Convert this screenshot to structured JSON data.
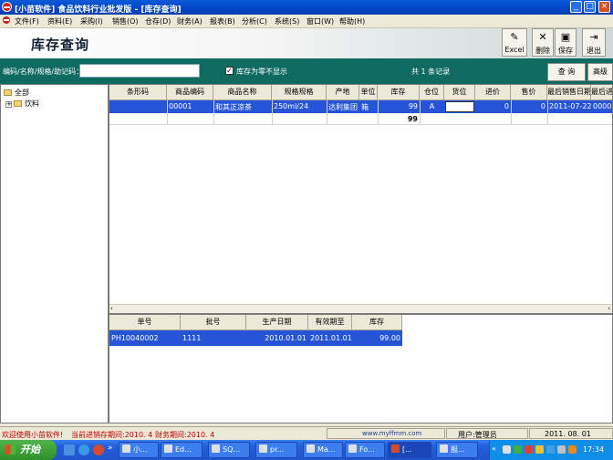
{
  "window": {
    "title": "[小苗软件] 食品饮料行业批发版 - [库存查询]"
  },
  "menu": [
    "文件(F)",
    "资料(E)",
    "采购(I)",
    "销售(O)",
    "仓存(D)",
    "财务(A)",
    "报表(B)",
    "分析(C)",
    "系统(S)",
    "窗口(W)",
    "帮助(H)"
  ],
  "page": {
    "title": "库存查询"
  },
  "toolbar": {
    "excel": "Excel",
    "delete": "删除",
    "save": "保存",
    "exit": "退出"
  },
  "search": {
    "label": "编码/名称/规格/助记码：",
    "value": "",
    "zero_checked": true,
    "zero_label": "库存为零不显示",
    "record_count": "共 1 条记录",
    "query_button": "查 询",
    "advanced_button": "高级"
  },
  "tree": {
    "root": "全部",
    "child": "饮料"
  },
  "stock_grid": {
    "columns": [
      "条形码",
      "商品编码",
      "商品名称",
      "规格规格",
      "产地",
      "单位",
      "库存",
      "仓位",
      "货位",
      "进价",
      "售价",
      "最后销售日期",
      "最后进"
    ],
    "rows": [
      [
        "",
        "00001",
        "和其正凉茶",
        "250ml/24",
        "达利集团",
        "箱",
        "99",
        "A",
        "",
        "0",
        "0",
        "2011-07-22",
        "0000"
      ]
    ],
    "total_stock": "99"
  },
  "batch_grid": {
    "columns": [
      "单号",
      "批号",
      "生产日期",
      "有效期至",
      "库存"
    ],
    "rows": [
      [
        "PH10040002",
        "1111",
        "2010.01.01",
        "2011.01.01",
        "99.00"
      ]
    ]
  },
  "status": {
    "welcome": "欢迎使用小苗软件!",
    "purchase_period": "当前进销存期间:2010. 4",
    "finance_period": "财务期间:2010. 4",
    "website": "www.myffmm.com",
    "user": "用户:管理员",
    "date": "2011. 08. 01"
  },
  "taskbar": {
    "start": "开始",
    "tasks": [
      "小...",
      "Ed...",
      "SQ...",
      "pr...",
      "Ma...",
      "Fo...",
      "[...",
      "报..."
    ],
    "clock": "17:34"
  }
}
